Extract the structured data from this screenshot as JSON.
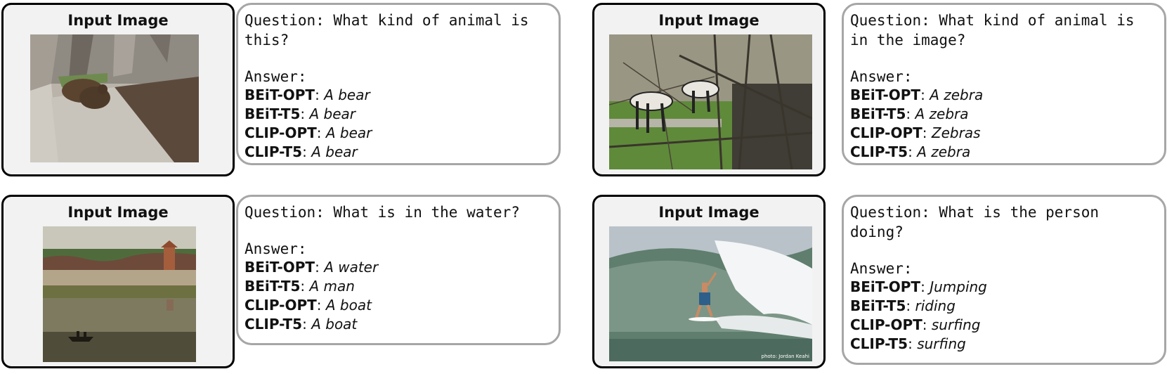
{
  "panels": [
    {
      "title": "Input Image",
      "question": "Question: What kind of animal is this?",
      "answer_label": "Answer:",
      "answers": [
        {
          "model": "BEiT-OPT",
          "sep": ":",
          "text": "A bear"
        },
        {
          "model": "BEiT-T5",
          "sep": ":",
          "text": "A bear"
        },
        {
          "model": "CLIP-OPT",
          "sep": ":",
          "text": "A bear"
        },
        {
          "model": "CLIP-T5",
          "sep": ":",
          "text": "A bear"
        }
      ]
    },
    {
      "title": "Input Image",
      "question": "Question: What kind of animal is in the image?",
      "answer_label": "Answer:",
      "answers": [
        {
          "model": "BEiT-OPT",
          "sep": ":",
          "text": "A zebra"
        },
        {
          "model": "BEiT-T5",
          "sep": ":",
          "text": "A zebra"
        },
        {
          "model": "CLIP-OPT",
          "sep": ":",
          "text": "Zebras"
        },
        {
          "model": "CLIP-T5",
          "sep": ":",
          "text": "A zebra"
        }
      ]
    },
    {
      "title": "Input Image",
      "question": "Question: What is in the water?",
      "answer_label": "Answer:",
      "answers": [
        {
          "model": "BEiT-OPT",
          "sep": ":",
          "text": "A water"
        },
        {
          "model": "BEiT-T5",
          "sep": ":",
          "text": "A man"
        },
        {
          "model": "CLIP-OPT",
          "sep": ":",
          "text": "A boat"
        },
        {
          "model": "CLIP-T5",
          "sep": ":",
          "text": "A boat"
        }
      ]
    },
    {
      "title": "Input Image",
      "question": "Question: What is the person doing?",
      "answer_label": "Answer:",
      "photo_credit": "photo: Jordan Keahi",
      "answers": [
        {
          "model": "BEiT-OPT",
          "sep": ":",
          "text": "Jumping"
        },
        {
          "model": "BEiT-T5",
          "sep": ":",
          "text": "riding"
        },
        {
          "model": "CLIP-OPT",
          "sep": ":",
          "text": "surfing"
        },
        {
          "model": "CLIP-T5",
          "sep": ":",
          "text": "surfing"
        }
      ]
    }
  ]
}
